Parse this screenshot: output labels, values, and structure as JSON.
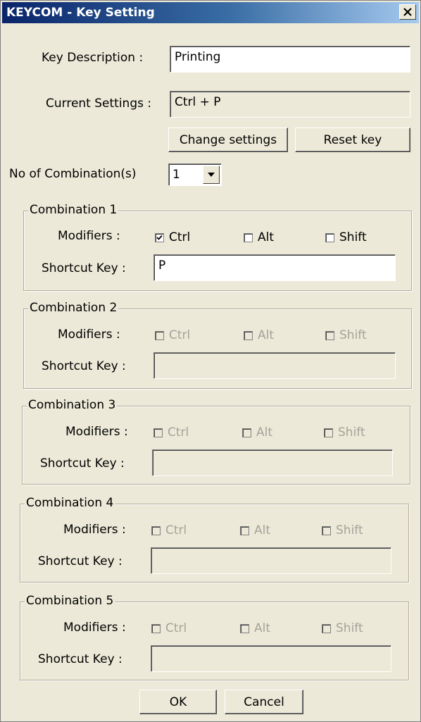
{
  "window": {
    "title": "KEYCOM - Key Setting",
    "close_icon": "close-icon"
  },
  "key_description": {
    "label": "Key Description :",
    "value": "Printing"
  },
  "current_settings": {
    "label": "Current Settings :",
    "value": "Ctrl + P"
  },
  "buttons": {
    "change_settings": "Change settings",
    "reset_key": "Reset key",
    "ok": "OK",
    "cancel": "Cancel"
  },
  "combination_count": {
    "label": "No of Combination(s)",
    "selected": "1",
    "arrow_icon": "dropdown-arrow-icon"
  },
  "combinations": [
    {
      "title": "Combination 1",
      "modifiers_label": "Modifiers :",
      "ctrl": "Ctrl",
      "alt": "Alt",
      "shift": "Shift",
      "ctrl_checked": true,
      "alt_checked": false,
      "shift_checked": false,
      "shortcut_label": "Shortcut Key :",
      "shortcut_value": "P",
      "enabled": true
    },
    {
      "title": "Combination 2",
      "modifiers_label": "Modifiers :",
      "ctrl": "Ctrl",
      "alt": "Alt",
      "shift": "Shift",
      "ctrl_checked": false,
      "alt_checked": false,
      "shift_checked": false,
      "shortcut_label": "Shortcut Key :",
      "shortcut_value": "",
      "enabled": false
    },
    {
      "title": "Combination 3",
      "modifiers_label": "Modifiers :",
      "ctrl": "Ctrl",
      "alt": "Alt",
      "shift": "Shift",
      "ctrl_checked": false,
      "alt_checked": false,
      "shift_checked": false,
      "shortcut_label": "Shortcut Key :",
      "shortcut_value": "",
      "enabled": false
    },
    {
      "title": "Combination 4",
      "modifiers_label": "Modifiers :",
      "ctrl": "Ctrl",
      "alt": "Alt",
      "shift": "Shift",
      "ctrl_checked": false,
      "alt_checked": false,
      "shift_checked": false,
      "shortcut_label": "Shortcut Key :",
      "shortcut_value": "",
      "enabled": false
    },
    {
      "title": "Combination 5",
      "modifiers_label": "Modifiers :",
      "ctrl": "Ctrl",
      "alt": "Alt",
      "shift": "Shift",
      "ctrl_checked": false,
      "alt_checked": false,
      "shift_checked": false,
      "shortcut_label": "Shortcut Key :",
      "shortcut_value": "",
      "enabled": false
    }
  ]
}
